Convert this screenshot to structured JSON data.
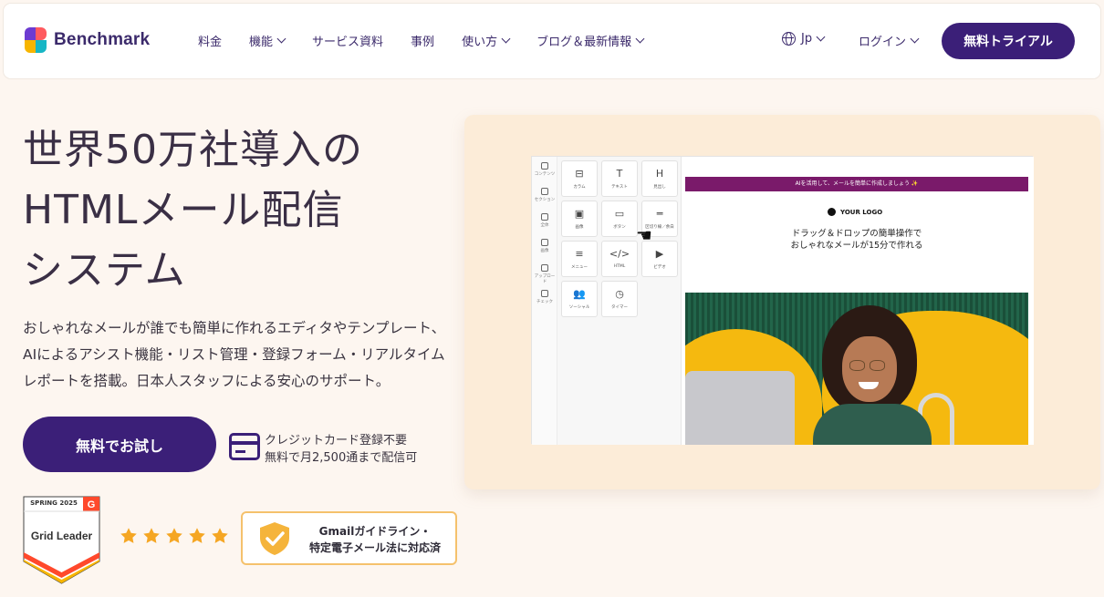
{
  "brand": {
    "name": "Benchmark"
  },
  "nav": {
    "items": [
      {
        "label": "料金",
        "has_dropdown": false
      },
      {
        "label": "機能",
        "has_dropdown": true
      },
      {
        "label": "サービス資料",
        "has_dropdown": false
      },
      {
        "label": "事例",
        "has_dropdown": false
      },
      {
        "label": "使い方",
        "has_dropdown": true
      },
      {
        "label": "ブログ＆最新情報",
        "has_dropdown": true
      }
    ],
    "language": "Jp",
    "login": "ログイン",
    "trial_button": "無料トライアル"
  },
  "hero": {
    "title_line1": "世界50万社導入の",
    "title_line2": "HTMLメール配信",
    "title_line3": "システム",
    "description": "おしゃれなメールが誰でも簡単に作れるエディタやテンプレート、AIによるアシスト機能・リスト管理・登録フォーム・リアルタイムレポートを搭載。日本人スタッフによる安心のサポート。",
    "cta_button": "無料でお試し",
    "note_line1": "クレジットカード登録不要",
    "note_line2": "無料で月2,500通まで配信可"
  },
  "badges": {
    "g2_season": "SPRING 2025",
    "g2_title": "Grid Leader",
    "rating_stars": 5,
    "compliance_line1": "Gmailガイドライン・",
    "compliance_line2": "特定電子メール法に対応済"
  },
  "editor_mockup": {
    "rail": [
      "コンテンツ",
      "セクション",
      "全体",
      "画像",
      "アップロード",
      "チェック"
    ],
    "blocks": [
      {
        "label": "カラム",
        "icon": "⊟"
      },
      {
        "label": "テキスト",
        "icon": "T"
      },
      {
        "label": "見出し",
        "icon": "H"
      },
      {
        "label": "画像",
        "icon": "▣"
      },
      {
        "label": "ボタン",
        "icon": "▭"
      },
      {
        "label": "区切り線／余白",
        "icon": "═"
      },
      {
        "label": "メニュー",
        "icon": "≡"
      },
      {
        "label": "HTML",
        "icon": "</>"
      },
      {
        "label": "ビデオ",
        "icon": "▶"
      },
      {
        "label": "ソーシャル",
        "icon": "👥"
      },
      {
        "label": "タイマー",
        "icon": "◷"
      }
    ],
    "banner_text": "AIを活用して、メールを簡単に作成しましょう ✨",
    "logo_text": "YOUR LOGO",
    "headline_line1": "ドラッグ＆ドロップの簡単操作で",
    "headline_line2": "おしゃれなメールが15分で作れる"
  },
  "colors": {
    "primary": "#3b1f78",
    "page_bg": "#fdf6f0",
    "mock_panel_bg": "#fcecd8",
    "banner": "#7a1a6a",
    "star": "#f5a623",
    "badge_border": "#f5c16c"
  }
}
